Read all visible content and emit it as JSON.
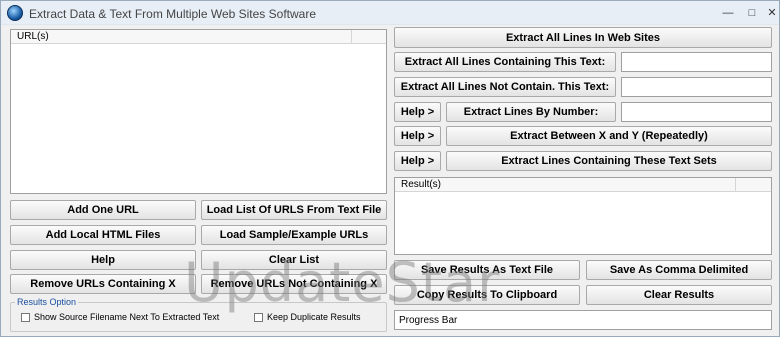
{
  "window": {
    "title": "Extract Data & Text From Multiple Web Sites Software"
  },
  "url_list": {
    "header": "URL(s)"
  },
  "results_list": {
    "header": "Result(s)"
  },
  "left_buttons": {
    "add_one_url": "Add One URL",
    "load_list_urls": "Load List Of URLS From Text File",
    "add_local_html": "Add Local HTML Files",
    "load_sample": "Load Sample/Example URLs",
    "help": "Help",
    "clear_list": "Clear List",
    "remove_containing": "Remove URLs Containing X",
    "remove_not_containing": "Remove URLs Not Containing X"
  },
  "results_option": {
    "legend": "Results Option",
    "show_source": "Show Source Filename Next To Extracted Text",
    "keep_duplicates": "Keep Duplicate Results"
  },
  "right_buttons": {
    "extract_all": "Extract All Lines In Web Sites",
    "extract_containing": "Extract All Lines Containing This Text:",
    "extract_not_containing": "Extract All Lines Not Contain. This Text:",
    "help1": "Help >",
    "extract_by_number": "Extract Lines By Number:",
    "help2": "Help >",
    "extract_between": "Extract Between X and Y (Repeatedly)",
    "help3": "Help >",
    "extract_text_sets": "Extract Lines Containing These Text Sets",
    "save_text": "Save Results As Text File",
    "save_csv": "Save As Comma Delimited",
    "copy_clipboard": "Copy Results To Clipboard",
    "clear_results": "Clear Results"
  },
  "progress": {
    "label": "Progress Bar"
  },
  "watermark": "UpdateStar"
}
